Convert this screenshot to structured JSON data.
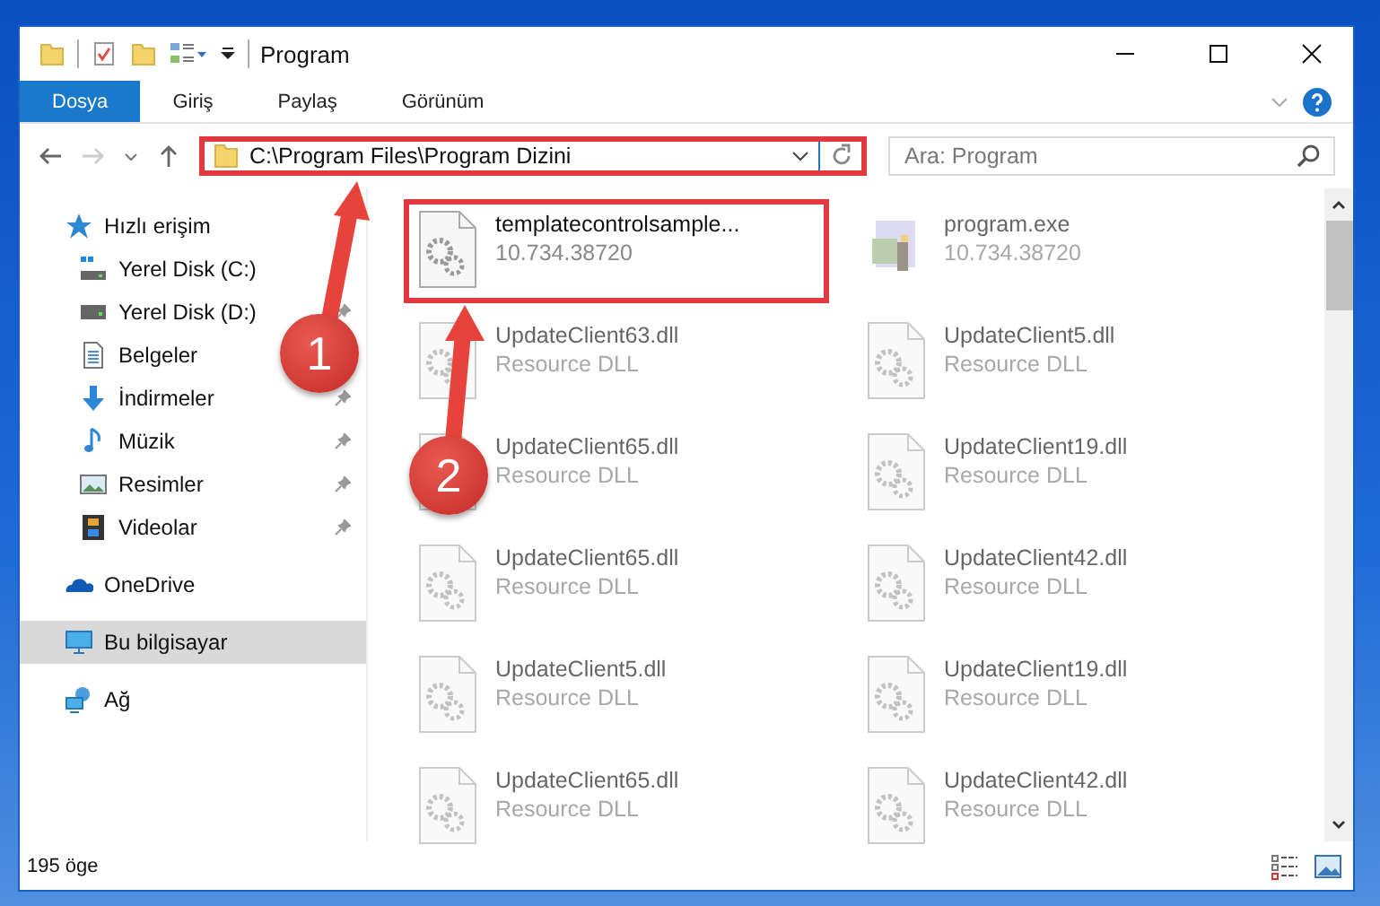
{
  "window": {
    "title": "Program"
  },
  "ribbon_tabs": [
    {
      "label": "Dosya",
      "selected": true
    },
    {
      "label": "Giriş",
      "selected": false
    },
    {
      "label": "Paylaş",
      "selected": false
    },
    {
      "label": "Görünüm",
      "selected": false
    }
  ],
  "address_bar": {
    "path": "C:\\Program Files\\Program Dizini",
    "highlighted": true
  },
  "search": {
    "placeholder": "Ara: Program"
  },
  "sidebar": {
    "items": [
      {
        "label": "Hızlı erişim",
        "kind": "star",
        "selected": false,
        "children": [
          {
            "label": "Yerel Disk (C:)",
            "kind": "drive-c",
            "pinned": false
          },
          {
            "label": "Yerel Disk (D:)",
            "kind": "drive",
            "pinned": true
          },
          {
            "label": "Belgeler",
            "kind": "documents",
            "pinned": false
          },
          {
            "label": "İndirmeler",
            "kind": "downloads",
            "pinned": true
          },
          {
            "label": "Müzik",
            "kind": "music",
            "pinned": true
          },
          {
            "label": "Resimler",
            "kind": "pictures",
            "pinned": true
          },
          {
            "label": "Videolar",
            "kind": "videos",
            "pinned": true
          }
        ]
      },
      {
        "label": "OneDrive",
        "kind": "cloud",
        "selected": false
      },
      {
        "label": "Bu bilgisayar",
        "kind": "computer",
        "selected": true
      },
      {
        "label": "Ağ",
        "kind": "network",
        "selected": false
      }
    ]
  },
  "files": [
    {
      "name": "templatecontrolsample...",
      "detail": "10.734.38720",
      "kind": "gears",
      "faded": false,
      "highlighted": true
    },
    {
      "name": "program.exe",
      "detail": "10.734.38720",
      "kind": "app",
      "faded": true,
      "highlighted": false
    },
    {
      "name": "UpdateClient63.dll",
      "detail": "Resource DLL",
      "kind": "gears",
      "faded": true,
      "highlighted": false
    },
    {
      "name": "UpdateClient5.dll",
      "detail": "Resource DLL",
      "kind": "gears",
      "faded": true,
      "highlighted": false
    },
    {
      "name": "UpdateClient65.dll",
      "detail": "Resource DLL",
      "kind": "gears",
      "faded": true,
      "highlighted": false
    },
    {
      "name": "UpdateClient19.dll",
      "detail": "Resource DLL",
      "kind": "gears",
      "faded": true,
      "highlighted": false
    },
    {
      "name": "UpdateClient65.dll",
      "detail": "Resource DLL",
      "kind": "gears",
      "faded": true,
      "highlighted": false
    },
    {
      "name": "UpdateClient42.dll",
      "detail": "Resource DLL",
      "kind": "gears",
      "faded": true,
      "highlighted": false
    },
    {
      "name": "UpdateClient5.dll",
      "detail": "Resource DLL",
      "kind": "gears",
      "faded": true,
      "highlighted": false
    },
    {
      "name": "UpdateClient19.dll",
      "detail": "Resource DLL",
      "kind": "gears",
      "faded": true,
      "highlighted": false
    },
    {
      "name": "UpdateClient65.dll",
      "detail": "Resource DLL",
      "kind": "gears",
      "faded": true,
      "highlighted": false
    },
    {
      "name": "UpdateClient42.dll",
      "detail": "Resource DLL",
      "kind": "gears",
      "faded": true,
      "highlighted": false
    }
  ],
  "status_bar": {
    "count": "195 öge"
  },
  "annotations": [
    {
      "label": "1"
    },
    {
      "label": "2"
    }
  ]
}
